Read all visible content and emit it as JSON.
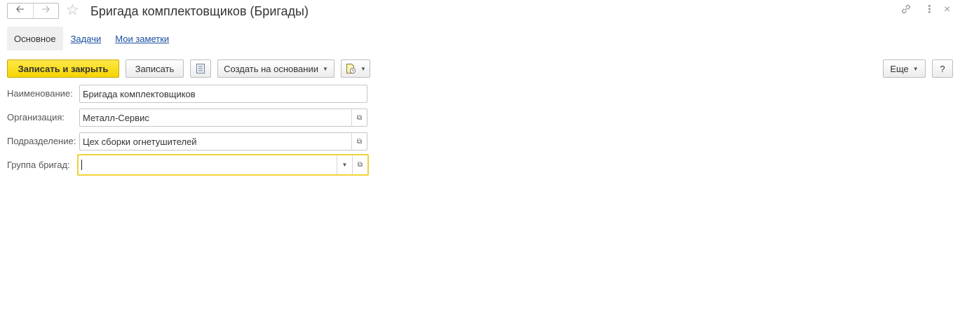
{
  "window": {
    "title": "Бригада комплектовщиков (Бригады)",
    "icons": [
      "back-arrow-icon",
      "forward-arrow-icon",
      "star-icon",
      "link-icon",
      "more-icon",
      "close-icon"
    ]
  },
  "tabs": [
    {
      "label": "Основное",
      "active": true
    },
    {
      "label": "Задачи",
      "active": false
    },
    {
      "label": "Мои заметки",
      "active": false
    }
  ],
  "toolbar": {
    "save_close_label": "Записать и закрыть",
    "save_label": "Записать",
    "create_based_label": "Создать на основании",
    "more_label": "Еще",
    "help_label": "?"
  },
  "form": {
    "name": {
      "label": "Наименование:",
      "value": "Бригада комплектовщиков"
    },
    "organization": {
      "label": "Организация:",
      "value": "Металл-Сервис"
    },
    "department": {
      "label": "Подразделение:",
      "value": "Цех сборки огнетушителей"
    },
    "group": {
      "label": "Группа бригад:",
      "value": ""
    }
  },
  "colors": {
    "primary_button": "#f6d400",
    "focus_border": "#f0d23a",
    "link": "#1c4fa0"
  }
}
